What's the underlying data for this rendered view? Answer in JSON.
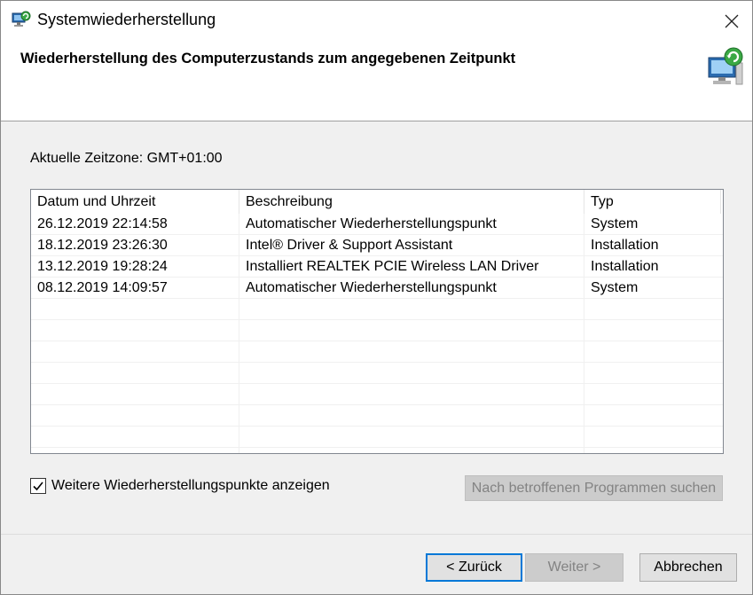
{
  "window": {
    "title": "Systemwiederherstellung"
  },
  "header": {
    "title": "Wiederherstellung des Computerzustands zum angegebenen Zeitpunkt"
  },
  "timezone": {
    "label": "Aktuelle Zeitzone: GMT+01:00"
  },
  "table": {
    "columns": [
      "Datum und Uhrzeit",
      "Beschreibung",
      "Typ"
    ],
    "sort_column": "Datum und Uhrzeit",
    "rows": [
      [
        "26.12.2019 22:14:58",
        "Automatischer Wiederherstellungspunkt",
        "System"
      ],
      [
        "18.12.2019 23:26:30",
        "Intel® Driver & Support Assistant",
        "Installation"
      ],
      [
        "13.12.2019 19:28:24",
        "Installiert REALTEK PCIE Wireless LAN Driver",
        "Installation"
      ],
      [
        "08.12.2019 14:09:57",
        "Automatischer Wiederherstellungspunkt",
        "System"
      ]
    ]
  },
  "options": {
    "show_more_label": "Weitere Wiederherstellungspunkte anzeigen",
    "show_more_checked": true
  },
  "buttons": {
    "scan": "Nach betroffenen Programmen suchen",
    "back": "< Zurück",
    "next": "Weiter >",
    "cancel": "Abbrechen"
  },
  "colors": {
    "accent": "#0078d7",
    "disabled_text": "#838383"
  }
}
